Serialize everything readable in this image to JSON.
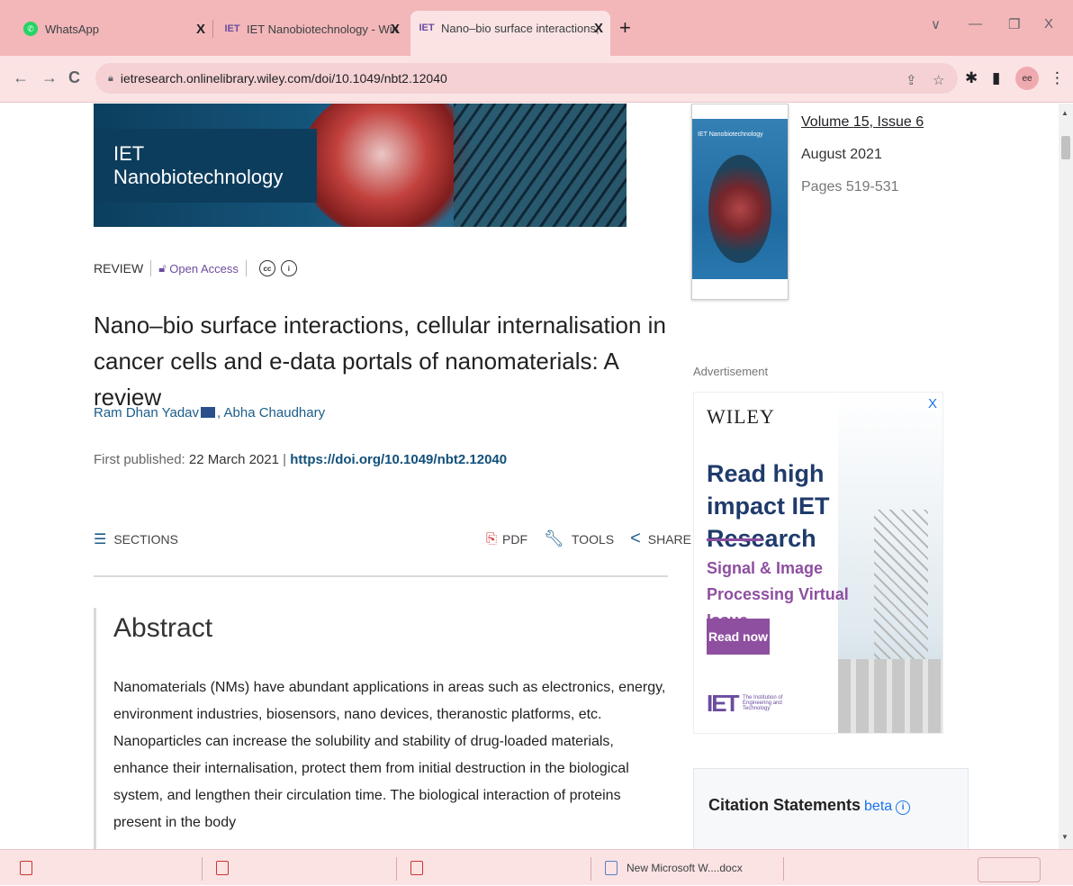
{
  "tabs": [
    {
      "title": "WhatsApp",
      "favicon": "whatsapp-icon"
    },
    {
      "title": "IET Nanobiotechnology - Wiley C",
      "favicon": "iet-icon"
    },
    {
      "title": "Nano–bio surface interactions, c",
      "favicon": "iet-icon"
    }
  ],
  "url": "ietresearch.onlinelibrary.wiley.com/doi/10.1049/nbt2.12040",
  "banner": {
    "journal": "IET Nanobiotechnology"
  },
  "article": {
    "type": "REVIEW",
    "access": "Open Access",
    "title": "Nano–bio surface interactions, cellular internalisation in cancer cells and e-data portals of nanomaterials: A review",
    "author1": "Ram Dhan Yadav",
    "author2": ", Abha Chaudhary",
    "first_published_label": "First published: ",
    "first_published_date": "22 March 2021",
    "pipe": " | ",
    "doi": "https://doi.org/10.1049/nbt2.12040"
  },
  "actions": {
    "sections": "SECTIONS",
    "pdf": "PDF",
    "tools": "TOOLS",
    "share": "SHARE"
  },
  "abstract": {
    "heading": "Abstract",
    "text": "Nanomaterials (NMs) have abundant applications in areas such as electronics, energy, environment industries, biosensors, nano devices, theranostic platforms, etc. Nanoparticles can increase the solubility and stability of drug-loaded materials, enhance their internalisation, protect them from initial destruction in the biological system, and lengthen their circulation time. The biological interaction of proteins present in the body"
  },
  "issue": {
    "volume_prefix": "Volume ",
    "volume_number": "15",
    "issue_sep": ", ",
    "issue_label": "Issue ",
    "issue_number": "6",
    "date": "August 2021",
    "pages": "Pages 519-531"
  },
  "ad": {
    "label": "Advertisement",
    "brand": "WILEY",
    "headline": "Read high impact IET Research",
    "subhead": "Signal & Image Processing Virtual Issue",
    "cta": "Read now",
    "iet_logo": "IET",
    "iet_org": "The Institution of Engineering and Technology"
  },
  "citation": {
    "title": "Citation Statements",
    "beta": "beta",
    "info": "i"
  },
  "downloads": [
    {
      "name": "",
      "kind": "pdf"
    },
    {
      "name": "",
      "kind": "pdf"
    },
    {
      "name": "",
      "kind": "pdf"
    },
    {
      "name": "New Microsoft W....docx",
      "kind": "word"
    }
  ],
  "colors": {
    "tabstrip": "#f3b7b9",
    "toolbar": "#fbe3e4",
    "link": "#12507a",
    "accent": "#8e4fa0"
  }
}
